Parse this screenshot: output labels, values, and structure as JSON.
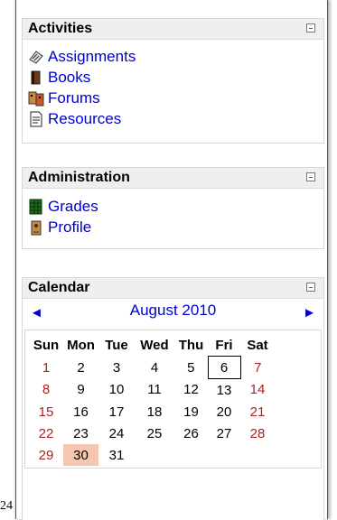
{
  "fragment": "24",
  "blocks": {
    "activities": {
      "title": "Activities",
      "items": [
        {
          "label": "Assignments",
          "icon": "assignment-icon"
        },
        {
          "label": "Books",
          "icon": "book-icon"
        },
        {
          "label": "Forums",
          "icon": "forum-icon"
        },
        {
          "label": "Resources",
          "icon": "resource-icon"
        }
      ]
    },
    "administration": {
      "title": "Administration",
      "items": [
        {
          "label": "Grades",
          "icon": "grades-icon"
        },
        {
          "label": "Profile",
          "icon": "profile-icon"
        }
      ]
    },
    "calendar": {
      "title": "Calendar",
      "prev": "◄",
      "next": "►",
      "month": "August 2010",
      "days": [
        "Sun",
        "Mon",
        "Tue",
        "Wed",
        "Thu",
        "Fri",
        "Sat"
      ],
      "weeks": [
        [
          "1",
          "2",
          "3",
          "4",
          "5",
          "6",
          "7"
        ],
        [
          "8",
          "9",
          "10",
          "11",
          "12",
          "13",
          "14"
        ],
        [
          "15",
          "16",
          "17",
          "18",
          "19",
          "20",
          "21"
        ],
        [
          "22",
          "23",
          "24",
          "25",
          "26",
          "27",
          "28"
        ],
        [
          "29",
          "30",
          "31",
          "",
          "",
          "",
          ""
        ]
      ],
      "today": "6",
      "highlighted": "30"
    }
  },
  "colors": {
    "link": "#0000cc",
    "weekend": "#b01f1f",
    "highlight": "#f5c7b0",
    "header_bg": "#efefef"
  }
}
